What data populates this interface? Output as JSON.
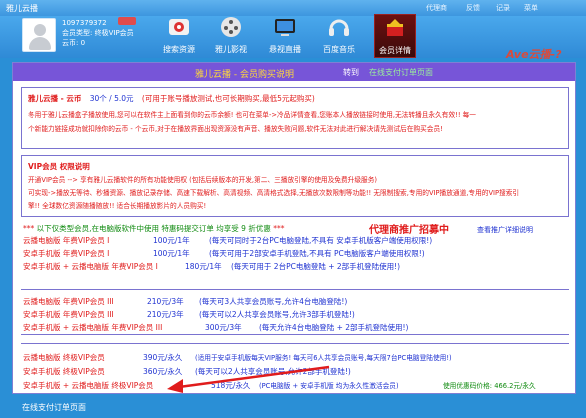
{
  "titlebar": {
    "title": "雅儿云播",
    "menu": [
      "代理商",
      "反馈",
      "记录",
      "菜单"
    ]
  },
  "user": {
    "id": "1097379372",
    "type": "会员类型:",
    "type_value": "终极VIP会员",
    "coins": "云币:",
    "coins_value": "0"
  },
  "nav": [
    {
      "label": "搜索资源",
      "icon": "search-icon"
    },
    {
      "label": "雅儿影视",
      "icon": "film-icon"
    },
    {
      "label": "悬视直播",
      "icon": "tv-icon"
    },
    {
      "label": "百度音乐",
      "icon": "music-icon"
    },
    {
      "label": "会员详情",
      "icon": "member-icon"
    }
  ],
  "logo": "Ave云播-?",
  "header": {
    "title": "雅儿云播 - 会员购买说明",
    "link_prefix": "转到",
    "link": "在线支付订单页面"
  },
  "coin_section": {
    "title": "雅儿云播 - 云币",
    "price": "30个 / 5.0元",
    "note": "(可用于账号播放测试,也可长期购买,最低5元起购买)",
    "line1": "冬用于雅儿云播盒子播放使用,您可以在软件主上面看到你的云币余额! 也可在菜单->冷品详情查看,您账本人播放链接时使用,无法转播且永久有效!! 每一",
    "line2": "个新能力链接成功就扣除你的云币 - 个云币,对于在播放界面出现资源没有声音、播放失败问题,软件无法对此进行解决请先测试后在购买会员!"
  },
  "vip_section": {
    "title": "VIP会员 权限说明",
    "line1": "开通VIP会员 --> 享有雅儿云播软件的所有功能使用权 (包括后续版本的开发,第二、三播放引擎的使用及免费升级服务)",
    "line2": "可实现->播放无等待、秒播资源、播放记录存储、高速下载解析、高清视频、高清格式选择,无播放次数限制等功能!! 无限制搜索,专用的VIP播放通道,专用的VIP搜索引",
    "line3": "擎!! 全球数亿资源随播随放!! 适合长期播放影片的人员购买!"
  },
  "promo": {
    "title": "以下仅类型会员,在电脑版软件中使用 特惠码提交订单 均享受 9 折优惠",
    "recruit": "代理商推广招募中",
    "link": "查看推广详细说明"
  },
  "plans1": [
    {
      "name": "云播电脑版 年费VIP会员 I",
      "price": "100元/1年",
      "desc": "(每天可同时于2台PC电脑登陆,不具有 安卓手机版客户端使用权限!)"
    },
    {
      "name": "安卓手机版 年费VIP会员 I",
      "price": "100元/1年",
      "desc": "(每天可用于2部安卓手机登陆,不具有 PC电脑版客户端使用权限!)"
    },
    {
      "name": "安卓手机版 + 云播电脑版 年费VIP会员 I",
      "price": "180元/1年",
      "desc": "(每天可用于 2台PC电脑登陆 + 2部手机登陆使用!)"
    }
  ],
  "plans2": [
    {
      "name": "云播电脑版 年费VIP会员 III",
      "price": "210元/3年",
      "desc": "(每天可3人共享会员账号,允许4台电脑登陆!)"
    },
    {
      "name": "安卓手机版 年费VIP会员 III",
      "price": "210元/3年",
      "desc": "(每天可以2人共享会员账号,允许3部手机登陆!)"
    },
    {
      "name": "安卓手机版 + 云播电脑版 年费VIP会员 III",
      "price": "300元/3年",
      "desc": "(每天允许4台电脑登陆 + 2部手机登陆使用!)"
    }
  ],
  "plans3": [
    {
      "name": "云播电脑版 终极VIP会员",
      "price": "390元/永久",
      "desc": "(适用于安卓手机版每天VIP服务! 每天可6人共享会员账号,每天限7台PC电脑登陆使用!)"
    },
    {
      "name": "安卓手机版 终极VIP会员",
      "price": "360元/永久",
      "desc": "(每天可以2人共享会员账号,允许2部手机登陆!)"
    },
    {
      "name": "安卓手机版 + 云播电脑版 终极VIP会员",
      "price": "518元/永久",
      "desc": "(PC电脑版 + 安卓手机版 均为永久性激活会员)",
      "extra": "使用优惠码价格: 466.2元/永久"
    }
  ],
  "bottom": {
    "link": "在线支付订单页面"
  },
  "colors": {
    "accent": "#7755d8",
    "red": "#e01c1c",
    "blue": "#1f32d1",
    "green": "#0f8a0f",
    "frame": "#2a8fd6"
  }
}
